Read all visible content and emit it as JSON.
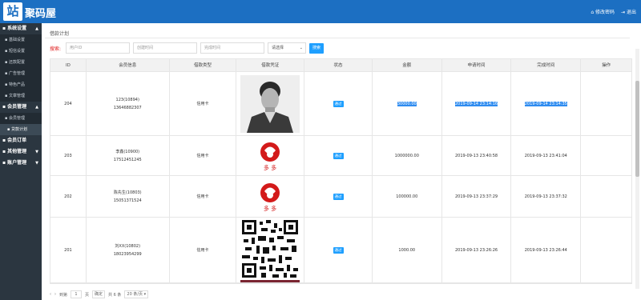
{
  "header": {
    "logo_glyph": "站",
    "app_name": "聚码屋",
    "change_password": "修改密码",
    "logout": "退出"
  },
  "sidebar": {
    "groups": [
      {
        "label": "系统设置",
        "arrow": "▲",
        "items": [
          "基础设置",
          "短信设置",
          "还款配置",
          "广告管理",
          "特色产品",
          "文章管理"
        ]
      },
      {
        "label": "会员管理",
        "arrow": "▲",
        "items": [
          "会员管理",
          "贷款计划"
        ]
      },
      {
        "label": "会员订单",
        "arrow": "",
        "items": []
      },
      {
        "label": "其他管理",
        "arrow": "▼",
        "items": []
      },
      {
        "label": "账户管理",
        "arrow": "▼",
        "items": []
      }
    ]
  },
  "main": {
    "breadcrumb": "借款计划",
    "search": {
      "label": "搜索:",
      "user_id_placeholder": "用户ID",
      "create_time_placeholder": "创建时间",
      "finish_time_placeholder": "完成时间",
      "select_value": "请选择",
      "button": "搜索"
    },
    "table": {
      "headers": [
        "ID",
        "会员信息",
        "借款类型",
        "借款凭证",
        "状态",
        "金额",
        "申请时间",
        "完成时间",
        "操作"
      ],
      "rows": [
        {
          "id": "204",
          "name": "123(10894)",
          "phone": "13646882307",
          "type": "信用卡",
          "status": "通过",
          "amount": "30000.00",
          "apply_time": "2019-09-14 23:14:16",
          "finish_time": "2019-09-14 23:14:35"
        },
        {
          "id": "203",
          "name": "李鑫(10900)",
          "phone": "17512451245",
          "type": "信用卡",
          "status": "通过",
          "amount": "1000000.00",
          "apply_time": "2019-09-13 23:40:58",
          "finish_time": "2019-09-13 23:41:04"
        },
        {
          "id": "202",
          "name": "陈先生(10803)",
          "phone": "15051371524",
          "type": "信用卡",
          "status": "通过",
          "amount": "100000.00",
          "apply_time": "2019-09-13 23:37:29",
          "finish_time": "2019-09-13 23:37:32"
        },
        {
          "id": "201",
          "name": "刘XX(10802)",
          "phone": "18023954299",
          "type": "信用卡",
          "status": "通过",
          "amount": "1000.00",
          "apply_time": "2019-09-13 23:26:26",
          "finish_time": "2019-09-13 23:26:44"
        }
      ],
      "logo_text": "多 多"
    },
    "pager": {
      "prev": "‹",
      "next": "›",
      "goto_label": "到第",
      "page": "1",
      "page_unit": "页",
      "confirm": "确定",
      "total": "共 6 条",
      "per_page": "20 条/页"
    }
  },
  "colors": {
    "topbar": "#1c6fc2",
    "sidebar": "#2b3640",
    "accent": "#1e9fff"
  }
}
